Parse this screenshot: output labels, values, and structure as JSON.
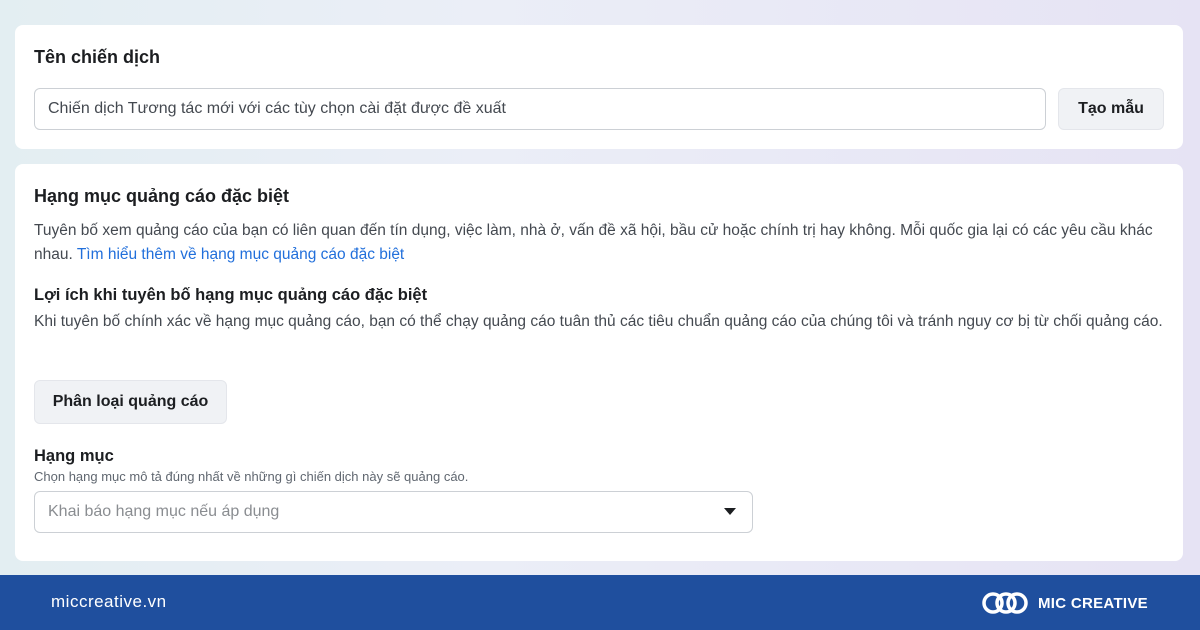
{
  "campaign_name": {
    "title": "Tên chiến dịch",
    "input_value": "Chiến dịch Tương tác mới với các tùy chọn cài đặt được đề xuất",
    "template_button": "Tạo mẫu"
  },
  "special_ad_category": {
    "title": "Hạng mục quảng cáo đặc biệt",
    "description": "Tuyên bố xem quảng cáo của bạn có liên quan đến tín dụng, việc làm, nhà ở, vấn đề xã hội, bầu cử hoặc chính trị hay không. Mỗi quốc gia lại có các yêu cầu khác nhau. ",
    "learn_more_link": "Tìm hiểu thêm về hạng mục quảng cáo đặc biệt",
    "benefit_title": "Lợi ích khi tuyên bố hạng mục quảng cáo đặc biệt",
    "benefit_description": "Khi tuyên bố chính xác về hạng mục quảng cáo, bạn có thể chạy quảng cáo tuân thủ các tiêu chuẩn quảng cáo của chúng tôi và tránh nguy cơ bị từ chối quảng cáo.",
    "classify_button": "Phân loại quảng cáo",
    "category_label": "Hạng mục",
    "category_help": "Chọn hạng mục mô tả đúng nhất về những gì chiến dịch này sẽ quảng cáo.",
    "category_placeholder": "Khai báo hạng mục nếu áp dụng",
    "dropdown_icon": "caret-down-icon"
  },
  "footer": {
    "url": "miccreative.vn",
    "brand_name": "MIC CREATIVE",
    "logo_icon": "mic-creative-logo",
    "background_color": "#1f4f9e"
  },
  "colors": {
    "link": "#216fdb",
    "button_bg": "#f0f2f5"
  }
}
